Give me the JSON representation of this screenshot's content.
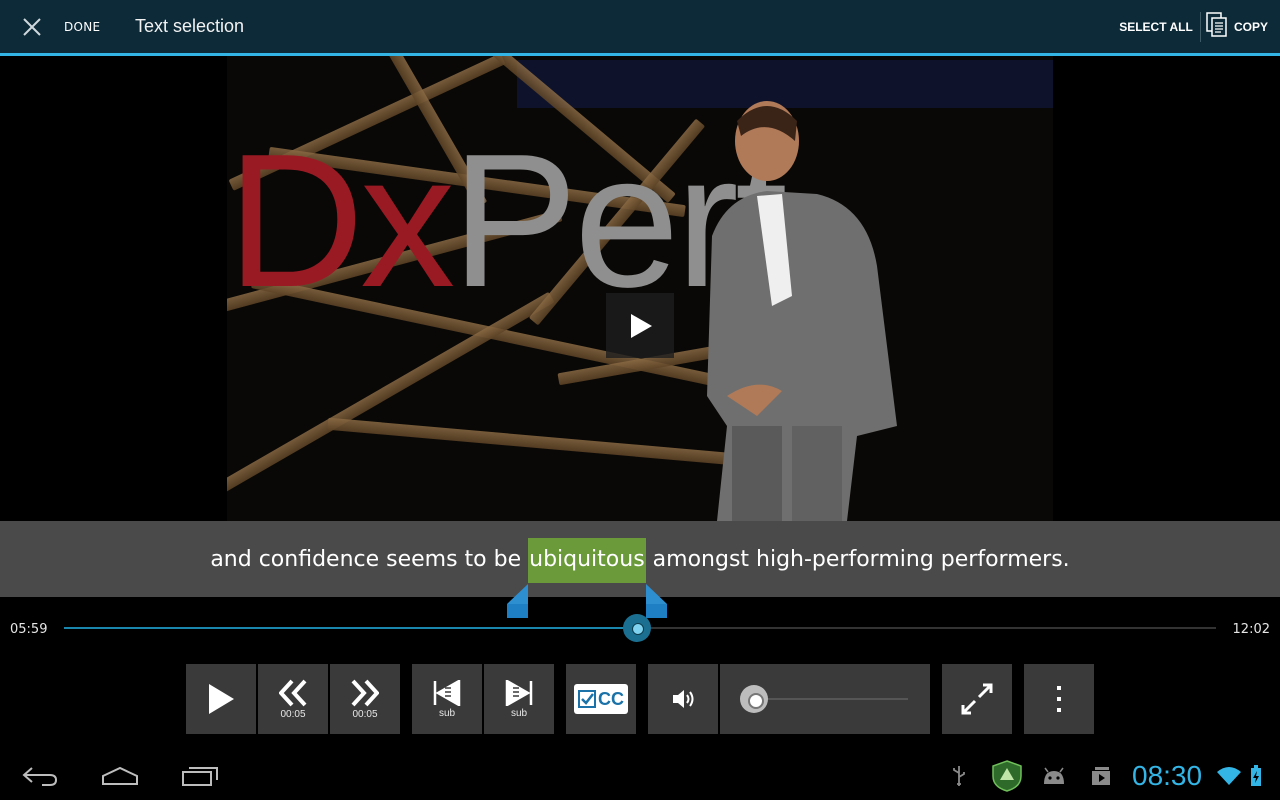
{
  "action_bar": {
    "done_label": "DONE",
    "title": "Text selection",
    "select_all_label": "SELECT ALL",
    "copy_label": "COPY"
  },
  "video": {
    "logo_fragment_left": "Dx",
    "logo_fragment_right": "Pert"
  },
  "subtitle": {
    "before": "and confidence seems to be ",
    "selected": "ubiquitous",
    "after": " amongst high-performing performers."
  },
  "player": {
    "current_time": "05:59",
    "total_time": "12:02",
    "progress_fraction": 0.497,
    "volume_fraction": 0.0
  },
  "controls": {
    "rewind_label": "00:05",
    "forward_label": "00:05",
    "prev_sub_label": "sub",
    "next_sub_label": "sub",
    "cc_label": "CC"
  },
  "system_bar": {
    "clock": "08:30"
  },
  "colors": {
    "accent": "#33b5e5",
    "selection_highlight": "#6a9a3a",
    "action_bar_bg": "#0d2a38",
    "handle": "#2e8fd0"
  }
}
